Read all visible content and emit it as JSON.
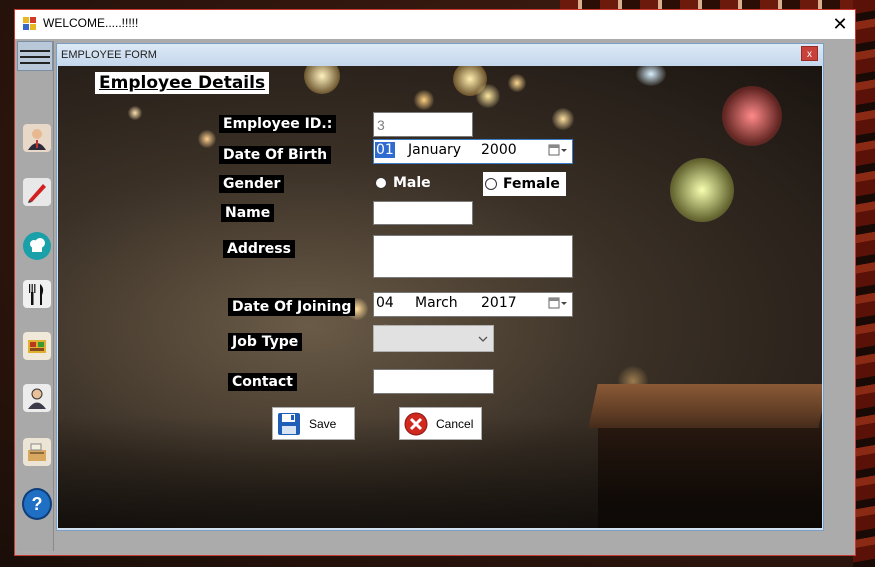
{
  "window": {
    "title": "WELCOME.....!!!!!",
    "close_glyph": "✕"
  },
  "child_form": {
    "title": "EMPLOYEE FORM",
    "close_glyph": "x"
  },
  "toolbar": {
    "items": [
      {
        "name": "employee",
        "icon": "person-icon"
      },
      {
        "name": "edit",
        "icon": "pen-icon"
      },
      {
        "name": "chef",
        "icon": "chef-hat-icon"
      },
      {
        "name": "menu",
        "icon": "fork-knife-icon"
      },
      {
        "name": "order",
        "icon": "food-tray-icon"
      },
      {
        "name": "customer",
        "icon": "user-icon"
      },
      {
        "name": "billing",
        "icon": "cash-register-icon"
      },
      {
        "name": "help",
        "icon": "help-icon",
        "glyph": "?"
      }
    ]
  },
  "form": {
    "heading": "Employee Details",
    "employee_id_label": "Employee ID.:",
    "employee_id_value": "3",
    "dob_label": "Date Of Birth",
    "dob": {
      "day": "01",
      "month": "January",
      "year": "2000"
    },
    "gender_label": "Gender",
    "gender_male": "Male",
    "gender_female": "Female",
    "name_label": "Name",
    "name_value": "",
    "address_label": "Address",
    "address_value": "",
    "doj_label": "Date Of Joining",
    "doj": {
      "day": "04",
      "month": "March",
      "year": "2017"
    },
    "job_type_label": "Job Type",
    "job_type_value": "",
    "contact_label": "Contact",
    "contact_value": "",
    "save_label": "Save",
    "cancel_label": "Cancel"
  }
}
